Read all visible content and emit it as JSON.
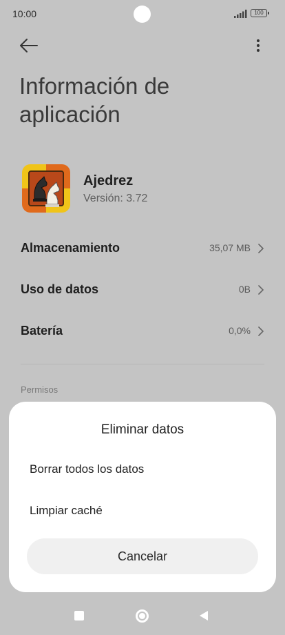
{
  "status_bar": {
    "time": "10:00",
    "battery": "100"
  },
  "header": {
    "title_line1": "Información de",
    "title_line2": "aplicación"
  },
  "app": {
    "name": "Ajedrez",
    "version": "Versión: 3.72"
  },
  "rows": [
    {
      "label": "Almacenamiento",
      "value": "35,07 MB"
    },
    {
      "label": "Uso de datos",
      "value": "0B"
    },
    {
      "label": "Batería",
      "value": "0,0%"
    }
  ],
  "section": {
    "label": "Permisos"
  },
  "sheet": {
    "title": "Eliminar datos",
    "items": [
      {
        "label": "Borrar todos los datos"
      },
      {
        "label": "Limpiar caché"
      }
    ],
    "cancel_label": "Cancelar"
  },
  "colors": {
    "overlay_background": "#c4c4c4",
    "sheet_background": "#ffffff",
    "cancel_button": "#f0f0f0",
    "app_icon_orange": "#e06a1c",
    "app_icon_yellow": "#f0c419"
  }
}
